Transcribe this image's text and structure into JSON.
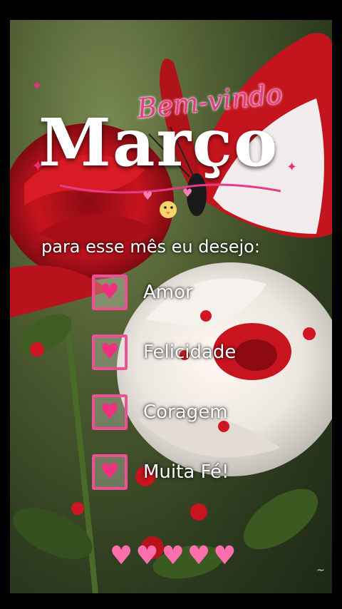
{
  "greeting": "Bem-vindo",
  "month": "Março",
  "subtitle": "para esse mês eu desejo:",
  "wishes": [
    {
      "label": "Amor"
    },
    {
      "label": "Felicidade"
    },
    {
      "label": "Coragem"
    },
    {
      "label": "Muita Fé!"
    }
  ],
  "icons": {
    "checkbox_mark": "heart-icon",
    "decorations": [
      "sparkle-icon",
      "heart-icon",
      "chick-icon",
      "butterfly",
      "rose"
    ]
  },
  "colors": {
    "accent_pink": "#e83a8a",
    "heart_pink": "#f0307f",
    "text": "#ffffff"
  }
}
